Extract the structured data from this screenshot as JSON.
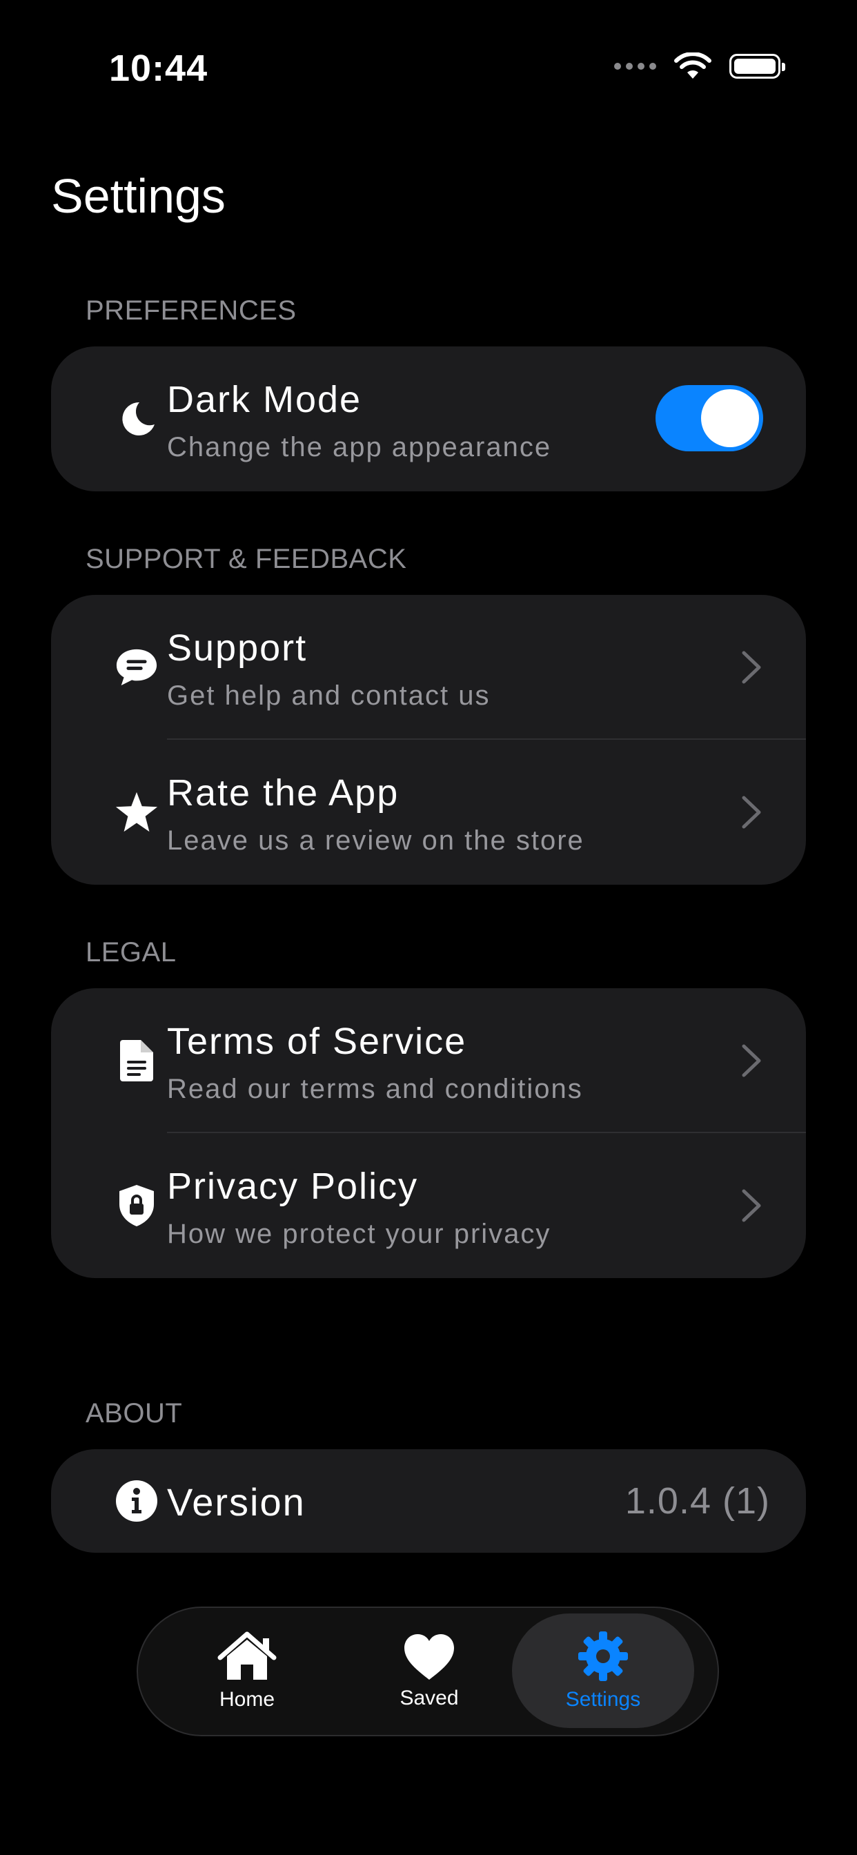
{
  "status_bar": {
    "time": "10:44"
  },
  "header": {
    "title": "Settings"
  },
  "sections": {
    "preferences": {
      "header": "PREFERENCES",
      "dark_mode": {
        "title": "Dark Mode",
        "subtitle": "Change the app appearance",
        "enabled": true
      }
    },
    "support": {
      "header": "SUPPORT & FEEDBACK",
      "items": [
        {
          "title": "Support",
          "subtitle": "Get help and contact us",
          "icon": "chat-bubble-icon"
        },
        {
          "title": "Rate the App",
          "subtitle": "Leave us a review on the store",
          "icon": "star-icon"
        }
      ]
    },
    "legal": {
      "header": "LEGAL",
      "items": [
        {
          "title": "Terms of Service",
          "subtitle": "Read our terms and conditions",
          "icon": "document-icon"
        },
        {
          "title": "Privacy Policy",
          "subtitle": "How we protect your privacy",
          "icon": "shield-lock-icon"
        }
      ]
    },
    "about": {
      "header": "ABOUT",
      "version": {
        "title": "Version",
        "value": "1.0.4 (1)",
        "icon": "info-icon"
      }
    }
  },
  "tabbar": {
    "tabs": [
      {
        "label": "Home",
        "icon": "house-icon"
      },
      {
        "label": "Saved",
        "icon": "heart-icon"
      },
      {
        "label": "Settings",
        "icon": "gear-icon",
        "active": true
      }
    ]
  },
  "colors": {
    "accent": "#0a84ff",
    "card": "#1c1c1e",
    "background": "#000000"
  }
}
